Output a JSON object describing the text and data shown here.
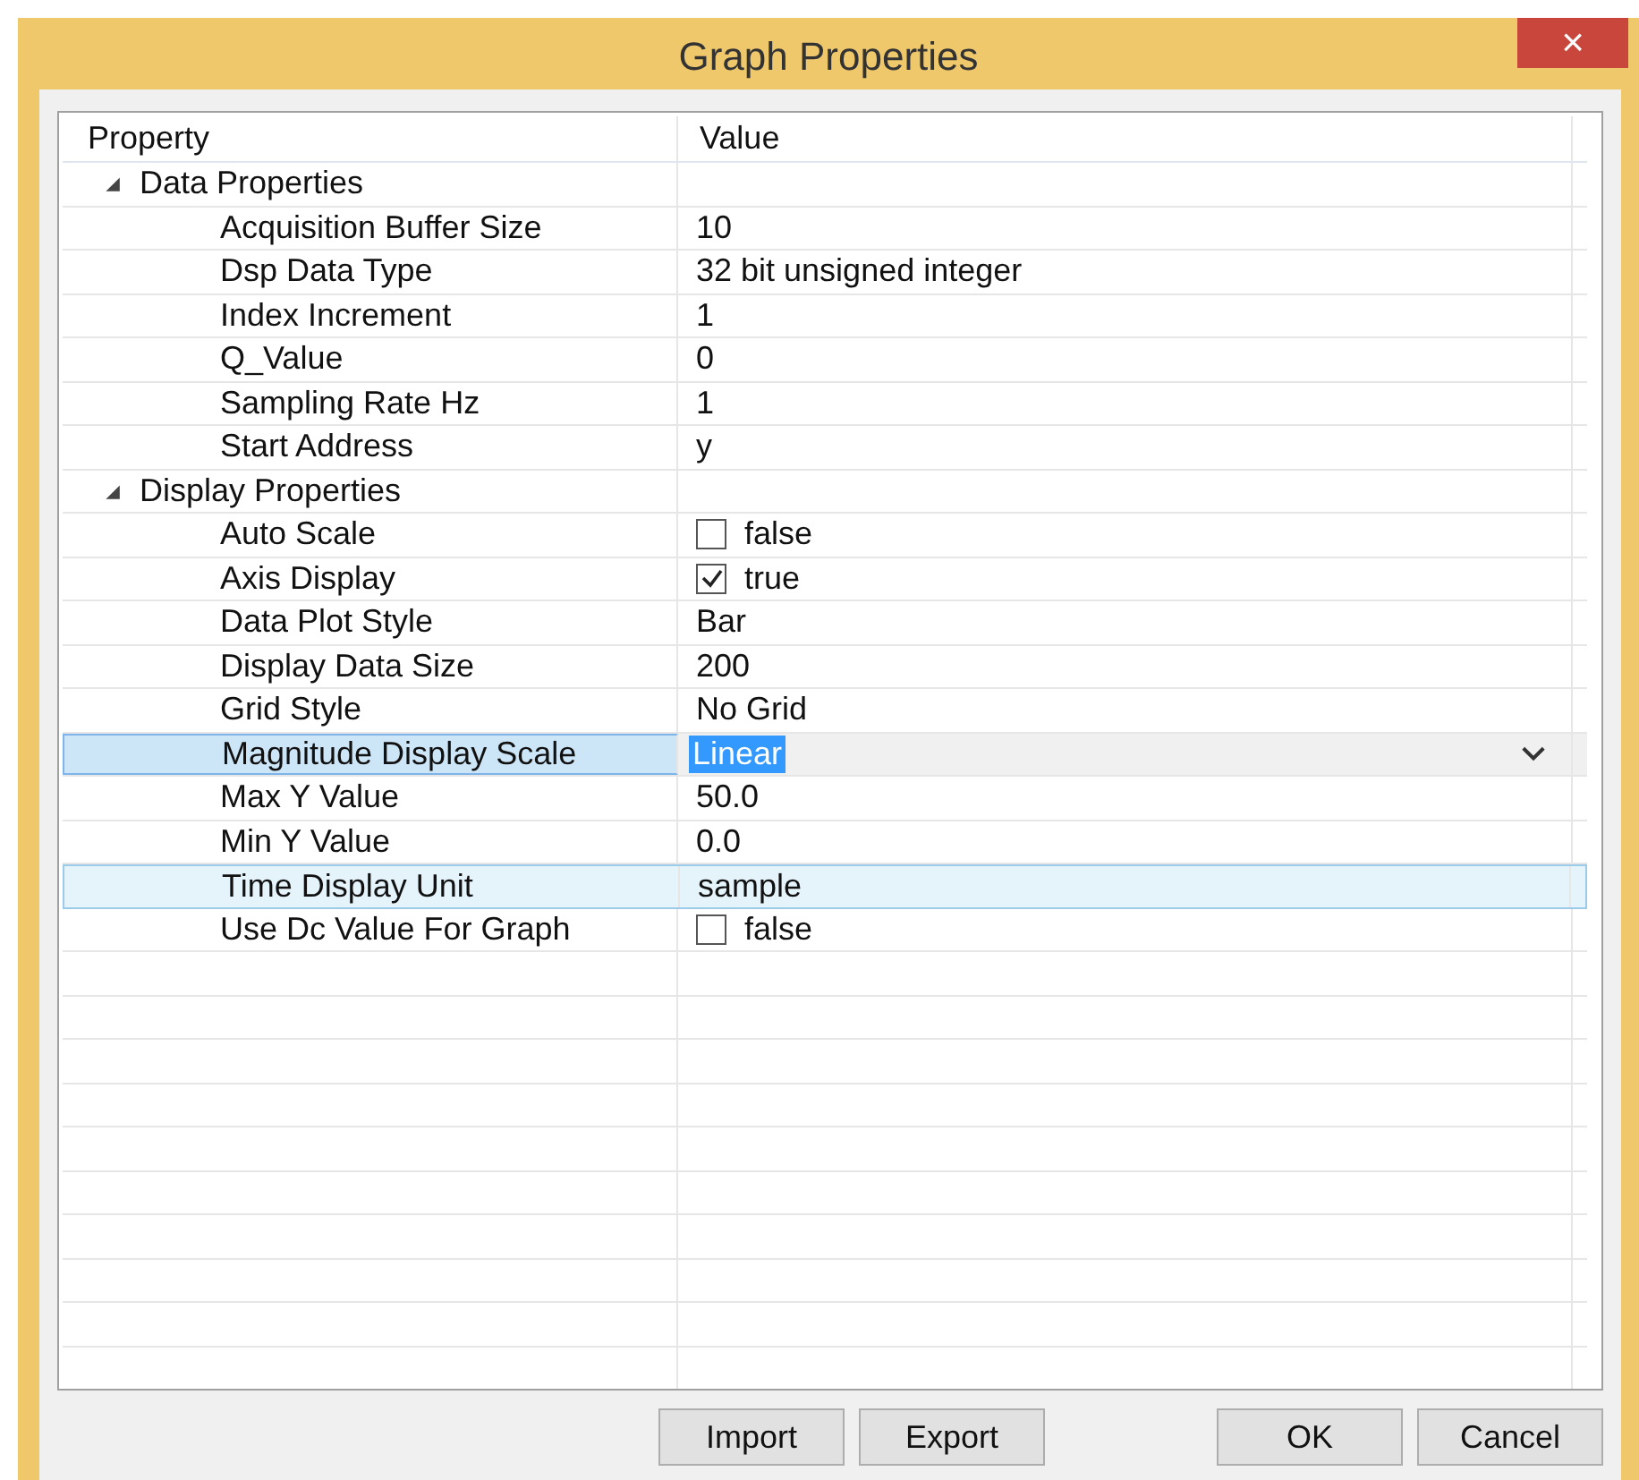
{
  "window": {
    "title": "Graph Properties",
    "close": "×"
  },
  "grid": {
    "columns": [
      "Property",
      "Value"
    ],
    "categories": [
      {
        "name": "Data Properties",
        "expanded": true,
        "properties": [
          {
            "name": "Acquisition Buffer Size",
            "kind": "text",
            "value": "10",
            "selected": false,
            "hovered": false
          },
          {
            "name": "Dsp Data Type",
            "kind": "text",
            "value": "32 bit unsigned integer",
            "selected": false,
            "hovered": false
          },
          {
            "name": "Index Increment",
            "kind": "text",
            "value": "1",
            "selected": false,
            "hovered": false
          },
          {
            "name": "Q_Value",
            "kind": "text",
            "value": "0",
            "selected": false,
            "hovered": false
          },
          {
            "name": "Sampling Rate Hz",
            "kind": "text",
            "value": "1",
            "selected": false,
            "hovered": false
          },
          {
            "name": "Start Address",
            "kind": "text",
            "value": "y",
            "selected": false,
            "hovered": false
          }
        ]
      },
      {
        "name": "Display Properties",
        "expanded": true,
        "properties": [
          {
            "name": "Auto Scale",
            "kind": "checkbox",
            "value": "false",
            "checked": false,
            "selected": false,
            "hovered": false
          },
          {
            "name": "Axis Display",
            "kind": "checkbox",
            "value": "true",
            "checked": true,
            "selected": false,
            "hovered": false
          },
          {
            "name": "Data Plot Style",
            "kind": "text",
            "value": "Bar",
            "selected": false,
            "hovered": false
          },
          {
            "name": "Display Data Size",
            "kind": "text",
            "value": "200",
            "selected": false,
            "hovered": false
          },
          {
            "name": "Grid Style",
            "kind": "text",
            "value": "No Grid",
            "selected": false,
            "hovered": false
          },
          {
            "name": "Magnitude Display Scale",
            "kind": "dropdown",
            "value": "Linear",
            "selected": true,
            "hovered": false
          },
          {
            "name": "Max Y Value",
            "kind": "text",
            "value": "50.0",
            "selected": false,
            "hovered": false
          },
          {
            "name": "Min Y Value",
            "kind": "text",
            "value": "0.0",
            "selected": false,
            "hovered": false
          },
          {
            "name": "Time Display Unit",
            "kind": "text",
            "value": "sample",
            "selected": false,
            "hovered": true
          },
          {
            "name": "Use Dc Value For Graph",
            "kind": "checkbox",
            "value": "false",
            "checked": false,
            "selected": false,
            "hovered": false
          }
        ]
      }
    ]
  },
  "buttons": [
    "Import",
    "Export",
    "OK",
    "Cancel"
  ]
}
